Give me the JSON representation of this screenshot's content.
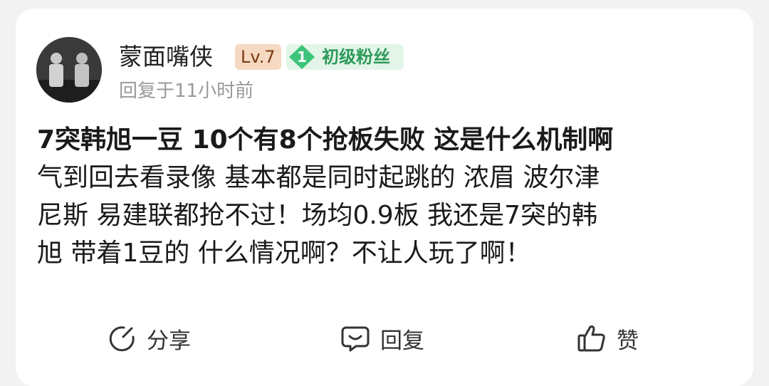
{
  "comment": {
    "user": {
      "name": "蒙面嘴侠",
      "level_badge": "Lv.7",
      "fan_level": "1",
      "fan_title": "初级粉丝"
    },
    "time": "回复于11小时前",
    "headline": "7突韩旭一豆 10个有8个抢板失败 这是什么机制啊",
    "body_lines": [
      "气到回去看录像 基本都是同时起跳的 浓眉 波尔津",
      "尼斯 易建联都抢不过！场均0.9板 我还是7突的韩",
      "旭 带着1豆的 什么情况啊？不让人玩了啊！"
    ]
  },
  "actions": {
    "share": "分享",
    "reply": "回复",
    "like": "赞"
  },
  "colors": {
    "level_badge_bg": "#f6d9c2",
    "fan_badge_bg": "#e3f5e9",
    "fan_badge_accent": "#3cc47a"
  }
}
